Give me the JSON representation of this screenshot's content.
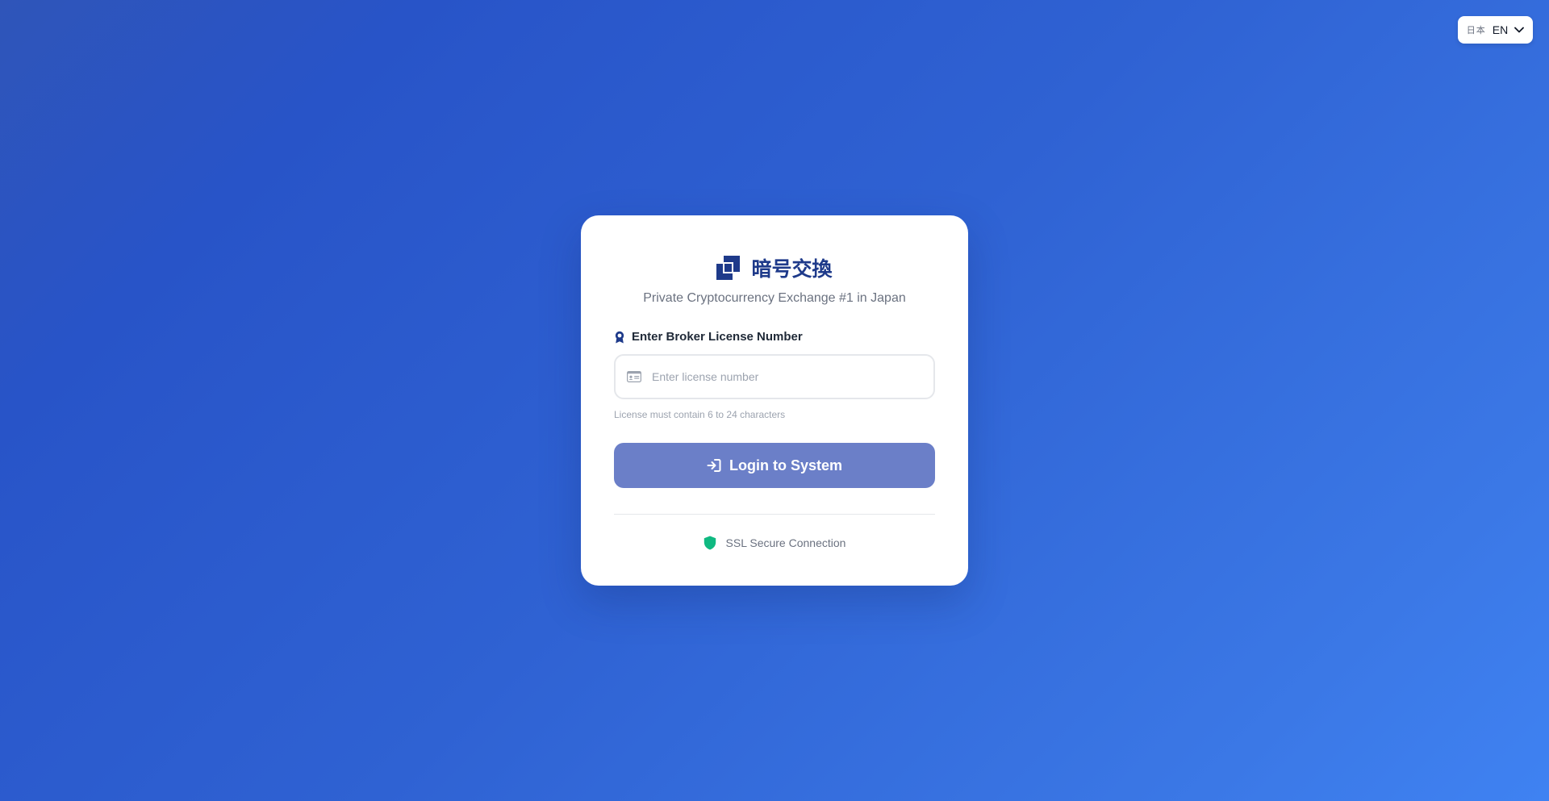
{
  "language": {
    "flag": "日本",
    "code": "EN"
  },
  "brand": {
    "name": "暗号交換",
    "tagline": "Private Cryptocurrency Exchange #1 in Japan"
  },
  "license_field": {
    "label": "Enter Broker License Number",
    "placeholder": "Enter license number",
    "value": "",
    "hint": "License must contain 6 to 24 characters"
  },
  "login_button": {
    "label": "Login to System"
  },
  "security": {
    "text": "SSL Secure Connection"
  },
  "colors": {
    "brand": "#1e3a8a",
    "button": "#6b7fc8",
    "secure": "#10b981"
  },
  "icons": {
    "language_chevron": "chevron-down-icon",
    "logo": "logo-mark-icon",
    "label": "award-icon",
    "input": "id-card-icon",
    "button": "sign-in-icon",
    "security": "shield-icon"
  }
}
